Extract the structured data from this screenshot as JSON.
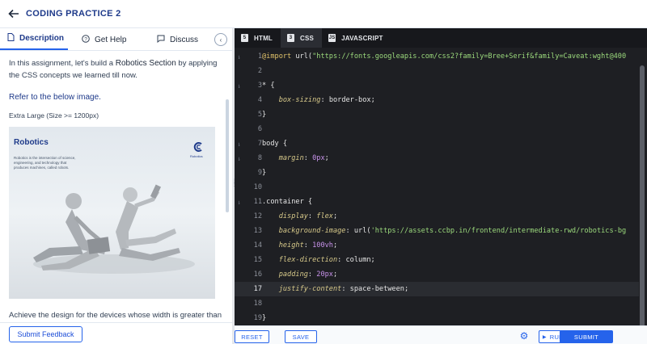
{
  "header": {
    "title": "CODING PRACTICE 2"
  },
  "left_panel": {
    "tabs": [
      {
        "label": "Description",
        "icon": "document-icon"
      },
      {
        "label": "Get Help",
        "icon": "help-circle-icon"
      },
      {
        "label": "Discuss",
        "icon": "chat-icon"
      }
    ],
    "intro_before": "In this assignment, let's build a ",
    "intro_highlight": "Robotics Section",
    "intro_after": " by applying the CSS concepts we learned till now.",
    "refer_heading": "Refer to the below image.",
    "size_label": "Extra Large (Size >= 1200px)",
    "preview": {
      "title": "Robotics",
      "text": "Robotics is the intersection of science, engineering, and technology that produces machines, called robots.",
      "logo_label": "Robotics"
    },
    "achieve_text": "Achieve the design for the devices whose width is greater than",
    "submit_feedback": "Submit Feedback"
  },
  "editor": {
    "tabs": [
      {
        "label": "HTML",
        "active": false
      },
      {
        "label": "CSS",
        "active": true
      },
      {
        "label": "JAVASCRIPT",
        "active": false
      }
    ],
    "active_line": 17,
    "lines": [
      {
        "n": "1",
        "mark": "⇂",
        "parts": [
          [
            "t-at",
            "@import"
          ],
          [
            "t-p",
            " "
          ],
          [
            "t-fn",
            "url("
          ],
          [
            "t-str",
            "\"https://fonts.googleapis.com/css2?family=Bree+Serif&family=Caveat:wght@400"
          ]
        ]
      },
      {
        "n": "2",
        "mark": "",
        "parts": []
      },
      {
        "n": "3",
        "mark": "⇂",
        "parts": [
          [
            "t-sel",
            "* {"
          ]
        ]
      },
      {
        "n": "4",
        "mark": "",
        "parts": [
          [
            "t-p",
            "    "
          ],
          [
            "t-prop",
            "box-sizing"
          ],
          [
            "t-p",
            ": "
          ],
          [
            "t-sel",
            "border-box"
          ],
          [
            "t-p",
            ";"
          ]
        ]
      },
      {
        "n": "5",
        "mark": "",
        "parts": [
          [
            "t-sel",
            "}"
          ]
        ]
      },
      {
        "n": "6",
        "mark": "",
        "parts": []
      },
      {
        "n": "7",
        "mark": "⇂",
        "parts": [
          [
            "t-sel",
            "body {"
          ]
        ]
      },
      {
        "n": "8",
        "mark": "⇂",
        "parts": [
          [
            "t-p",
            "    "
          ],
          [
            "t-prop",
            "margin"
          ],
          [
            "t-p",
            ": "
          ],
          [
            "t-val",
            "0px"
          ],
          [
            "t-p",
            ";"
          ]
        ]
      },
      {
        "n": "9",
        "mark": "",
        "parts": [
          [
            "t-sel",
            "}"
          ]
        ]
      },
      {
        "n": "10",
        "mark": "",
        "parts": []
      },
      {
        "n": "11",
        "mark": "⇂",
        "parts": [
          [
            "t-sel",
            ".container {"
          ]
        ]
      },
      {
        "n": "12",
        "mark": "",
        "parts": [
          [
            "t-p",
            "    "
          ],
          [
            "t-prop",
            "display"
          ],
          [
            "t-p",
            ": "
          ],
          [
            "t-prop",
            "flex"
          ],
          [
            "t-p",
            ";"
          ]
        ]
      },
      {
        "n": "13",
        "mark": "",
        "parts": [
          [
            "t-p",
            "    "
          ],
          [
            "t-prop",
            "background-image"
          ],
          [
            "t-p",
            ": "
          ],
          [
            "t-fn",
            "url("
          ],
          [
            "t-str",
            "'https://assets.ccbp.in/frontend/intermediate-rwd/robotics-bg"
          ]
        ]
      },
      {
        "n": "14",
        "mark": "",
        "parts": [
          [
            "t-p",
            "    "
          ],
          [
            "t-prop",
            "height"
          ],
          [
            "t-p",
            ": "
          ],
          [
            "t-val",
            "100vh"
          ],
          [
            "t-p",
            ";"
          ]
        ]
      },
      {
        "n": "15",
        "mark": "",
        "parts": [
          [
            "t-p",
            "    "
          ],
          [
            "t-prop",
            "flex-direction"
          ],
          [
            "t-p",
            ": "
          ],
          [
            "t-sel",
            "column"
          ],
          [
            "t-p",
            ";"
          ]
        ]
      },
      {
        "n": "16",
        "mark": "",
        "parts": [
          [
            "t-p",
            "    "
          ],
          [
            "t-prop",
            "padding"
          ],
          [
            "t-p",
            ": "
          ],
          [
            "t-val",
            "20px"
          ],
          [
            "t-p",
            ";"
          ]
        ]
      },
      {
        "n": "17",
        "mark": "",
        "parts": [
          [
            "t-p",
            "    "
          ],
          [
            "t-prop",
            "justify-content"
          ],
          [
            "t-p",
            ": "
          ],
          [
            "t-sel",
            "space-between"
          ],
          [
            "t-p",
            ";"
          ]
        ]
      },
      {
        "n": "18",
        "mark": "",
        "parts": []
      },
      {
        "n": "19",
        "mark": "",
        "parts": [
          [
            "t-sel",
            "}"
          ]
        ]
      }
    ]
  },
  "footer": {
    "reset": "RESET",
    "save": "SAVE",
    "run_code": "RUN CODE",
    "submit": "SUBMIT"
  },
  "colors": {
    "accent": "#2563eb",
    "title": "#1e3a8a",
    "editor_bg": "#1e1f23"
  }
}
